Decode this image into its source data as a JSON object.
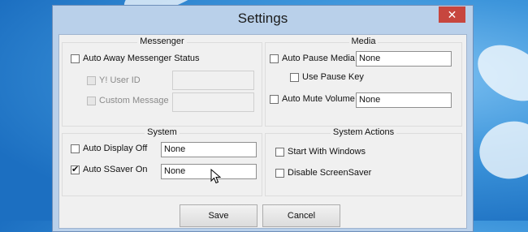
{
  "window": {
    "title": "Settings",
    "close_label": "✕"
  },
  "messenger": {
    "title": "Messenger",
    "auto_away_label": "Auto Away Messenger Status",
    "user_id_label": "Y! User ID",
    "user_id_value": "",
    "custom_message_label": "Custom Message",
    "custom_message_value": ""
  },
  "media": {
    "title": "Media",
    "auto_pause_label": "Auto Pause Media",
    "auto_pause_value": "None",
    "use_pause_key_label": "Use Pause Key",
    "auto_mute_label": "Auto Mute Volume",
    "auto_mute_value": "None"
  },
  "system": {
    "title": "System",
    "auto_display_off_label": "Auto Display Off",
    "auto_display_off_value": "None",
    "auto_ssaver_label": "Auto SSaver On",
    "auto_ssaver_checked": true,
    "auto_ssaver_value": "None"
  },
  "system_actions": {
    "title": "System Actions",
    "start_with_windows_label": "Start With Windows",
    "disable_screensaver_label": "Disable ScreenSaver"
  },
  "buttons": {
    "save_label": "Save",
    "cancel_label": "Cancel"
  }
}
